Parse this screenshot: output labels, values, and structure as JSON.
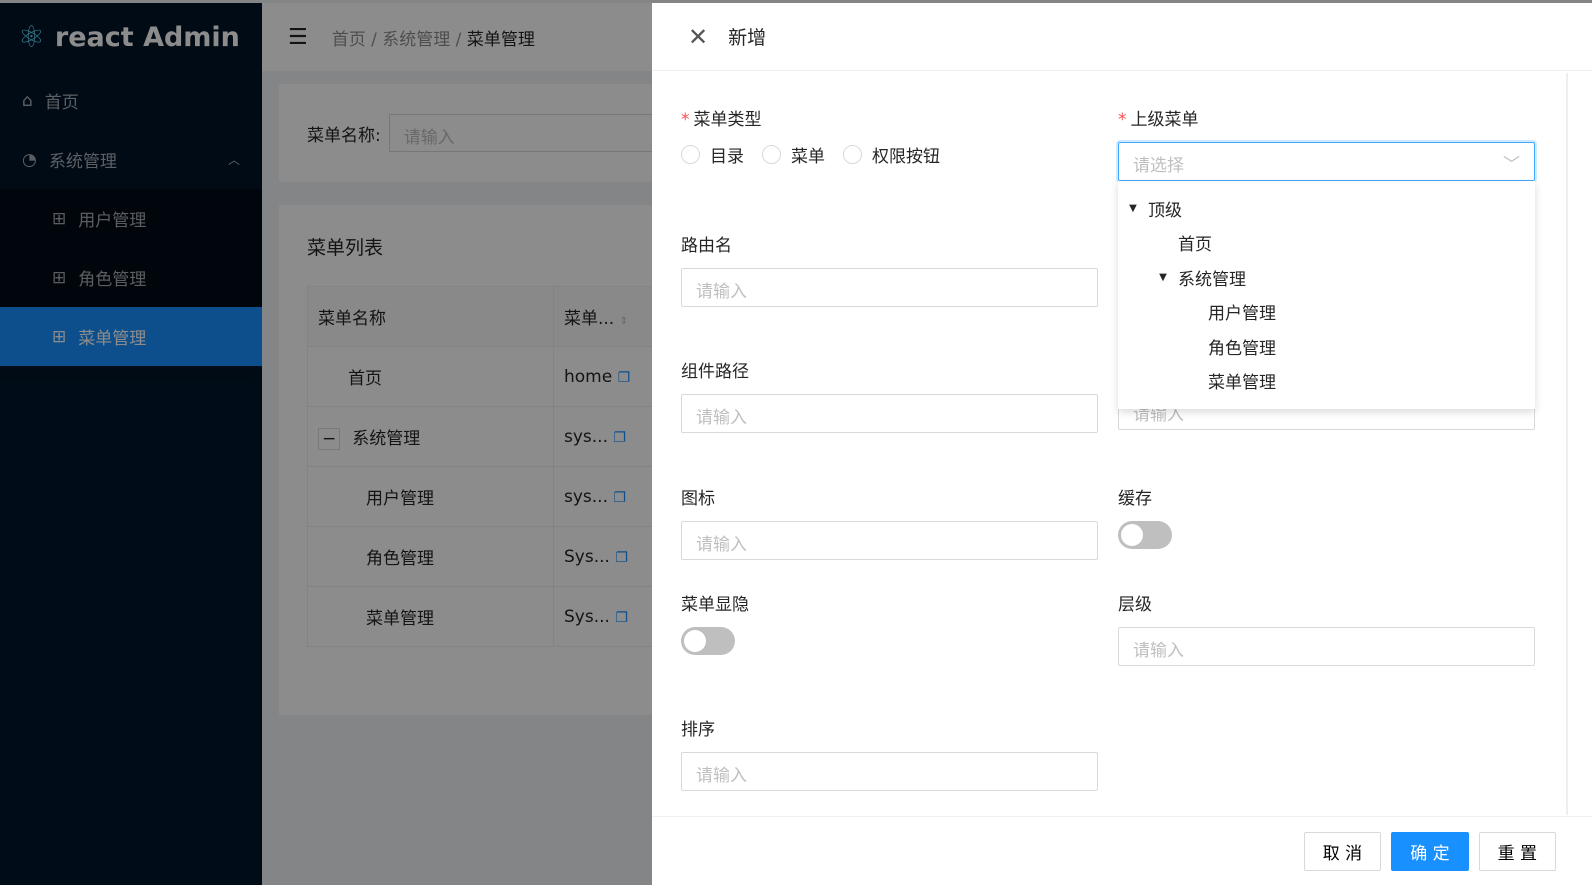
{
  "app": {
    "title": "react Admin"
  },
  "sidebar": {
    "items": [
      {
        "label": "首页",
        "icon": "home-icon"
      },
      {
        "label": "系统管理",
        "icon": "pie-chart-icon"
      }
    ],
    "sub": [
      {
        "label": "用户管理"
      },
      {
        "label": "角色管理"
      },
      {
        "label": "菜单管理",
        "active": true
      }
    ]
  },
  "breadcrumb": [
    "首页",
    "系统管理",
    "菜单管理"
  ],
  "search": {
    "label": "菜单名称:",
    "placeholder": "请输入"
  },
  "list": {
    "title": "菜单列表",
    "headers": [
      "菜单名称",
      "菜单..."
    ],
    "rows": [
      [
        "首页",
        "home"
      ],
      [
        "系统管理",
        "sys..."
      ],
      [
        "用户管理",
        "sys..."
      ],
      [
        "角色管理",
        "Sys..."
      ],
      [
        "菜单管理",
        "Sys..."
      ]
    ]
  },
  "drawer": {
    "title": "新增",
    "type": {
      "label": "菜单类型",
      "options": [
        "目录",
        "菜单",
        "权限按钮"
      ]
    },
    "parent": {
      "label": "上级菜单",
      "placeholder": "请选择"
    },
    "route": {
      "label": "路由名",
      "placeholder": "请输入"
    },
    "component": {
      "label": "组件路径",
      "placeholder": "请输入"
    },
    "hidden_right": {
      "placeholder": "请输入"
    },
    "icon": {
      "label": "图标",
      "placeholder": "请输入"
    },
    "cache": {
      "label": "缓存",
      "on": false
    },
    "visible": {
      "label": "菜单显隐",
      "on": false
    },
    "level": {
      "label": "层级",
      "placeholder": "请输入"
    },
    "sort": {
      "label": "排序",
      "placeholder": "请输入"
    },
    "tree": [
      "顶级",
      "首页",
      "系统管理",
      "用户管理",
      "角色管理",
      "菜单管理"
    ],
    "buttons": {
      "cancel": "取 消",
      "ok": "确 定",
      "reset": "重 置"
    }
  },
  "colors": {
    "primary": "#1890ff",
    "sider": "#001529"
  }
}
